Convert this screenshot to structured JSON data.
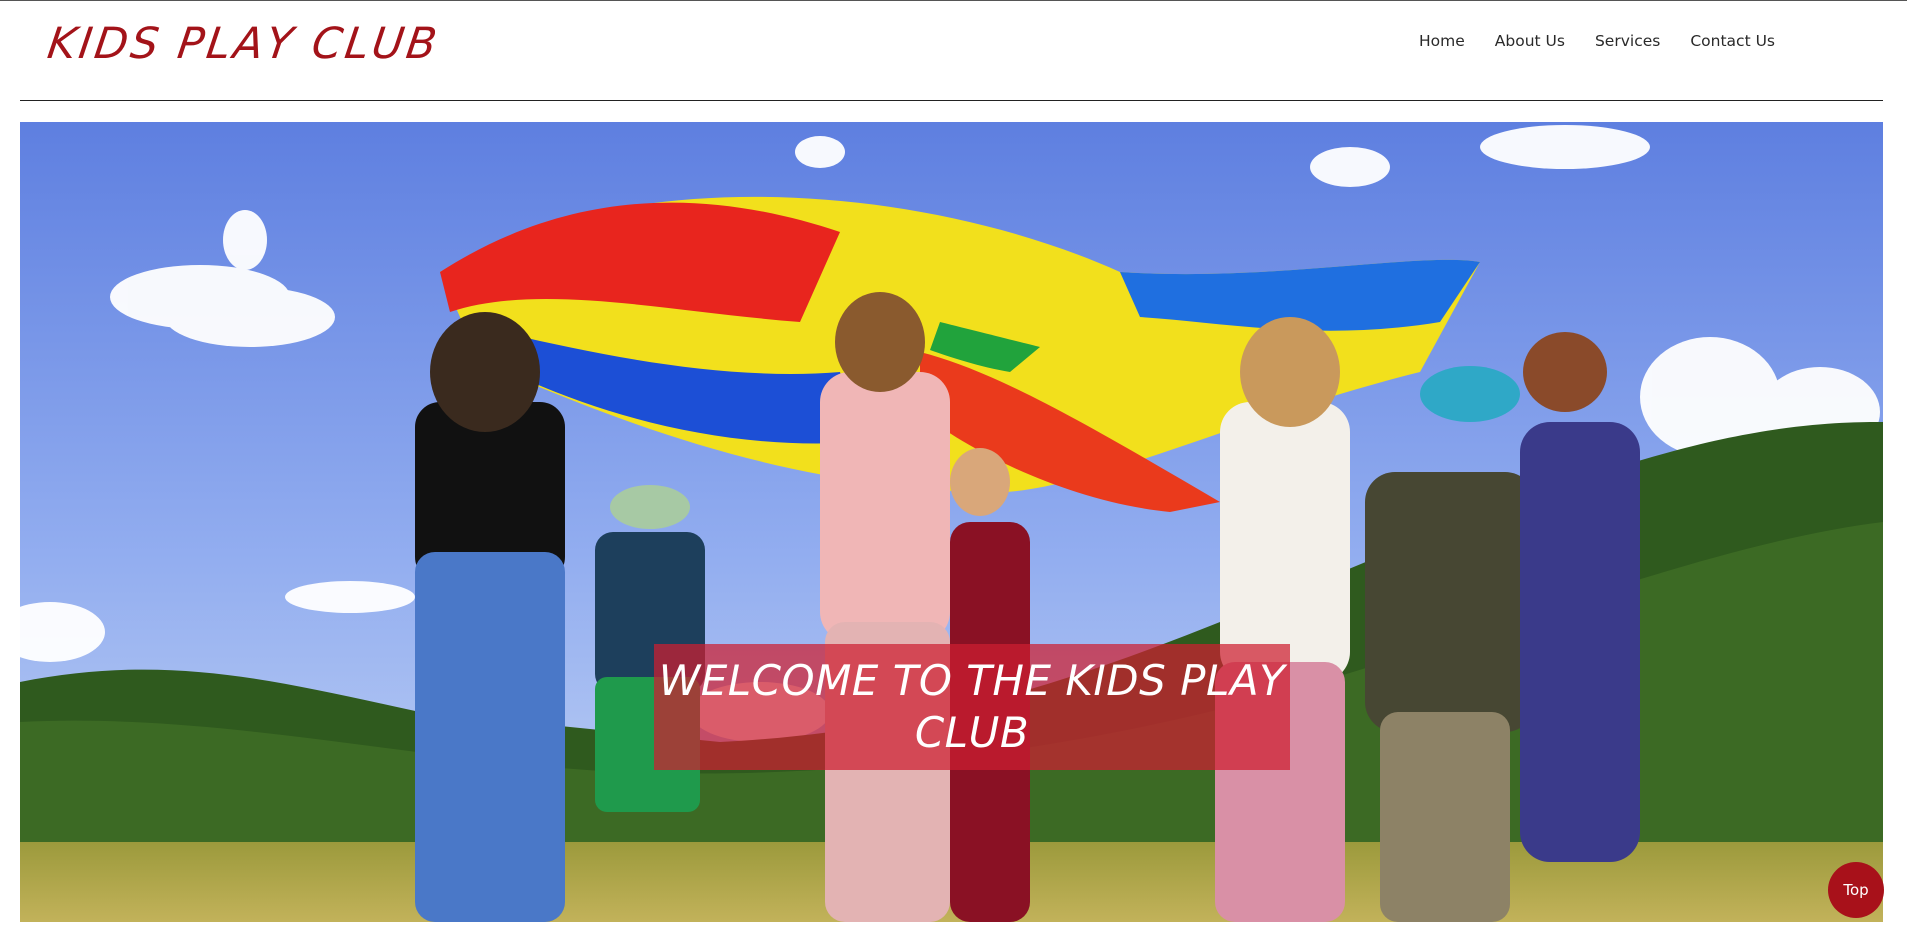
{
  "site": {
    "logo": "KIDS PLAY CLUB"
  },
  "nav": {
    "items": [
      {
        "label": "Home"
      },
      {
        "label": "About Us"
      },
      {
        "label": "Services"
      },
      {
        "label": "Contact Us"
      }
    ]
  },
  "hero": {
    "title": "WELCOME TO THE KIDS PLAY CLUB",
    "image_subject": "children holding a rainbow parachute in a meadow"
  },
  "back_to_top": {
    "label": "Top"
  },
  "colors": {
    "brand": "#a31319",
    "overlay": "#cd1e30",
    "button": "#a8111a"
  }
}
